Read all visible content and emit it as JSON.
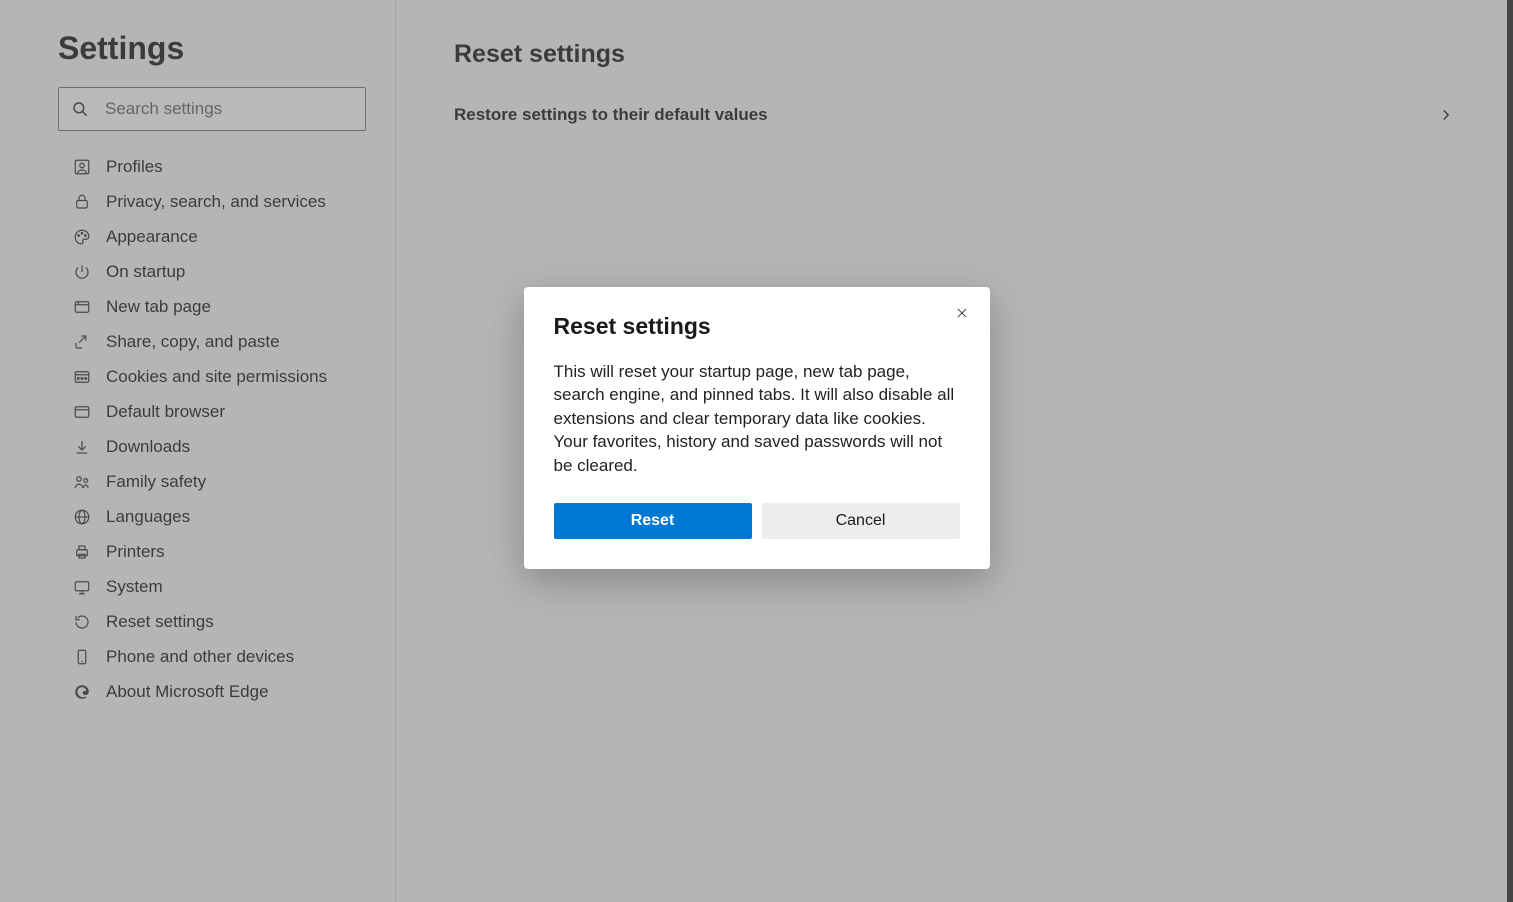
{
  "sidebar": {
    "title": "Settings",
    "search_placeholder": "Search settings",
    "items": [
      {
        "icon": "profile",
        "label": "Profiles"
      },
      {
        "icon": "lock",
        "label": "Privacy, search, and services"
      },
      {
        "icon": "appearance",
        "label": "Appearance"
      },
      {
        "icon": "power",
        "label": "On startup"
      },
      {
        "icon": "newtab",
        "label": "New tab page"
      },
      {
        "icon": "share",
        "label": "Share, copy, and paste"
      },
      {
        "icon": "cookies",
        "label": "Cookies and site permissions"
      },
      {
        "icon": "browser",
        "label": "Default browser"
      },
      {
        "icon": "download",
        "label": "Downloads"
      },
      {
        "icon": "family",
        "label": "Family safety"
      },
      {
        "icon": "language",
        "label": "Languages"
      },
      {
        "icon": "printer",
        "label": "Printers"
      },
      {
        "icon": "system",
        "label": "System"
      },
      {
        "icon": "reset",
        "label": "Reset settings"
      },
      {
        "icon": "phone",
        "label": "Phone and other devices"
      },
      {
        "icon": "about",
        "label": "About Microsoft Edge"
      }
    ]
  },
  "main": {
    "title": "Reset settings",
    "option_label": "Restore settings to their default values"
  },
  "dialog": {
    "title": "Reset settings",
    "body": "This will reset your startup page, new tab page, search engine, and pinned tabs. It will also disable all extensions and clear temporary data like cookies. Your favorites, history and saved passwords will not be cleared.",
    "reset_label": "Reset",
    "cancel_label": "Cancel"
  }
}
